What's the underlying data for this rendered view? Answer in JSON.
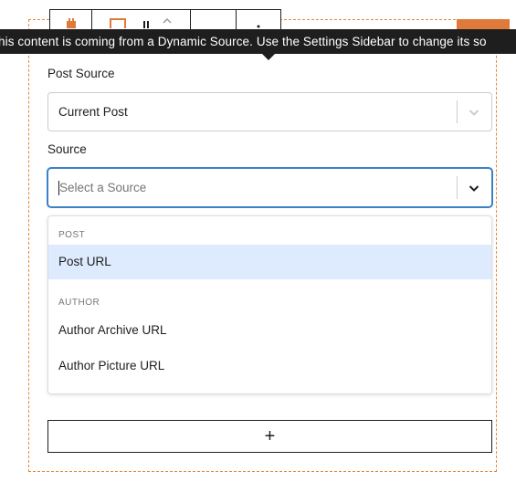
{
  "tooltip": {
    "text": "his content is coming from a Dynamic Source. Use the Settings Sidebar to change its so"
  },
  "post_source": {
    "label": "Post Source",
    "value": "Current Post"
  },
  "source": {
    "label": "Source",
    "placeholder": "Select a Source"
  },
  "menu": {
    "groups": [
      {
        "label": "POST",
        "items": [
          "Post URL"
        ]
      },
      {
        "label": "AUTHOR",
        "items": [
          "Author Archive URL",
          "Author Picture URL"
        ]
      }
    ],
    "active_item": "Post URL"
  },
  "add_button": {
    "label": "+"
  },
  "colors": {
    "accent": "#3b82c4",
    "highlight": "#deebff",
    "outline": "#e08a3c",
    "tooltip_bg": "#1e1e1e"
  }
}
